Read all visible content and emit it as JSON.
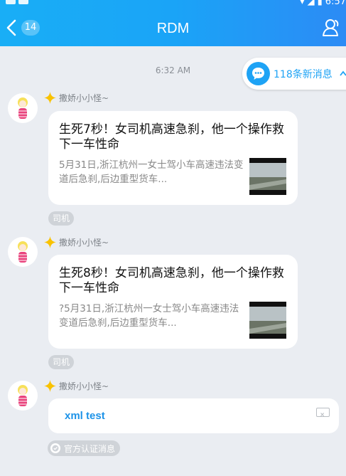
{
  "header": {
    "title": "RDM",
    "back_badge": "14",
    "status_time": "6:57"
  },
  "chat": {
    "time_label": "6:32 AM",
    "new_messages_label": "118条新消息"
  },
  "messages": [
    {
      "sender": "撒娇小小怪~",
      "title": "生死7秒！女司机高速急刹，他一个操作救下一车性命",
      "desc": "5月31日,浙江杭州一女士驾小车高速违法变道后急刹,后边重型货车...",
      "tag": "司机"
    },
    {
      "sender": "撒娇小小怪~",
      "title": "生死8秒！女司机高速急刹，他一个操作救下一车性命",
      "desc": "?5月31日,浙江杭州一女士驾小车高速违法变道后急刹,后边重型货车...",
      "tag": "司机"
    },
    {
      "sender": "撒娇小小怪~",
      "text": "xml test",
      "tag": "官方认证消息"
    }
  ],
  "colors": {
    "header_blue": "#1aa4f7",
    "accent": "#1ea3f5",
    "background": "#eaedf2"
  }
}
